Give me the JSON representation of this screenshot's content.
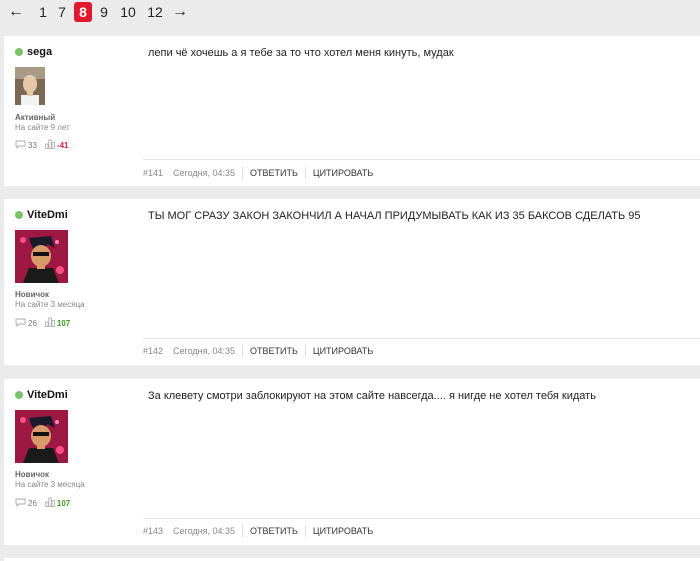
{
  "pagination": {
    "prev": "←",
    "pages": [
      "1",
      "7",
      "8",
      "9",
      "10",
      "12"
    ],
    "active": "8",
    "next": "→"
  },
  "colors": {
    "accent": "#e0182d",
    "online": "#7ac36a",
    "negative": "#d9263a",
    "positive": "#3c9a28"
  },
  "posts": [
    {
      "author": "sega",
      "rank": "Активный",
      "since": "На сайте 9 лет",
      "comments": "33",
      "rating": "-41",
      "text": "лепи чё хочешь а я тебе за то что хотел меня кинуть, мудак",
      "number": "#141",
      "date": "Сегодня, 04:35",
      "reply": "ОТВЕТИТЬ",
      "quote": "ЦИТИРОВАТЬ"
    },
    {
      "author": "ViteDmi",
      "rank": "Новичок",
      "since": "На сайте 3 месяца",
      "comments": "26",
      "rating": "107",
      "text": "ТЫ МОГ СРАЗУ ЗАКОН ЗАКОНЧИЛ А НАЧАЛ ПРИДУМЫВАТЬ КАК ИЗ 35 БАКСОВ СДЕЛАТЬ 95",
      "number": "#142",
      "date": "Сегодня, 04:35",
      "reply": "ОТВЕТИТЬ",
      "quote": "ЦИТИРОВАТЬ"
    },
    {
      "author": "ViteDmi",
      "rank": "Новичок",
      "since": "На сайте 3 месяца",
      "comments": "26",
      "rating": "107",
      "text": "За клевету смотри заблокируют на этом сайте навсегда.... я нигде не хотел тебя кидать",
      "number": "#143",
      "date": "Сегодня, 04:35",
      "reply": "ОТВЕТИТЬ",
      "quote": "ЦИТИРОВАТЬ"
    }
  ]
}
